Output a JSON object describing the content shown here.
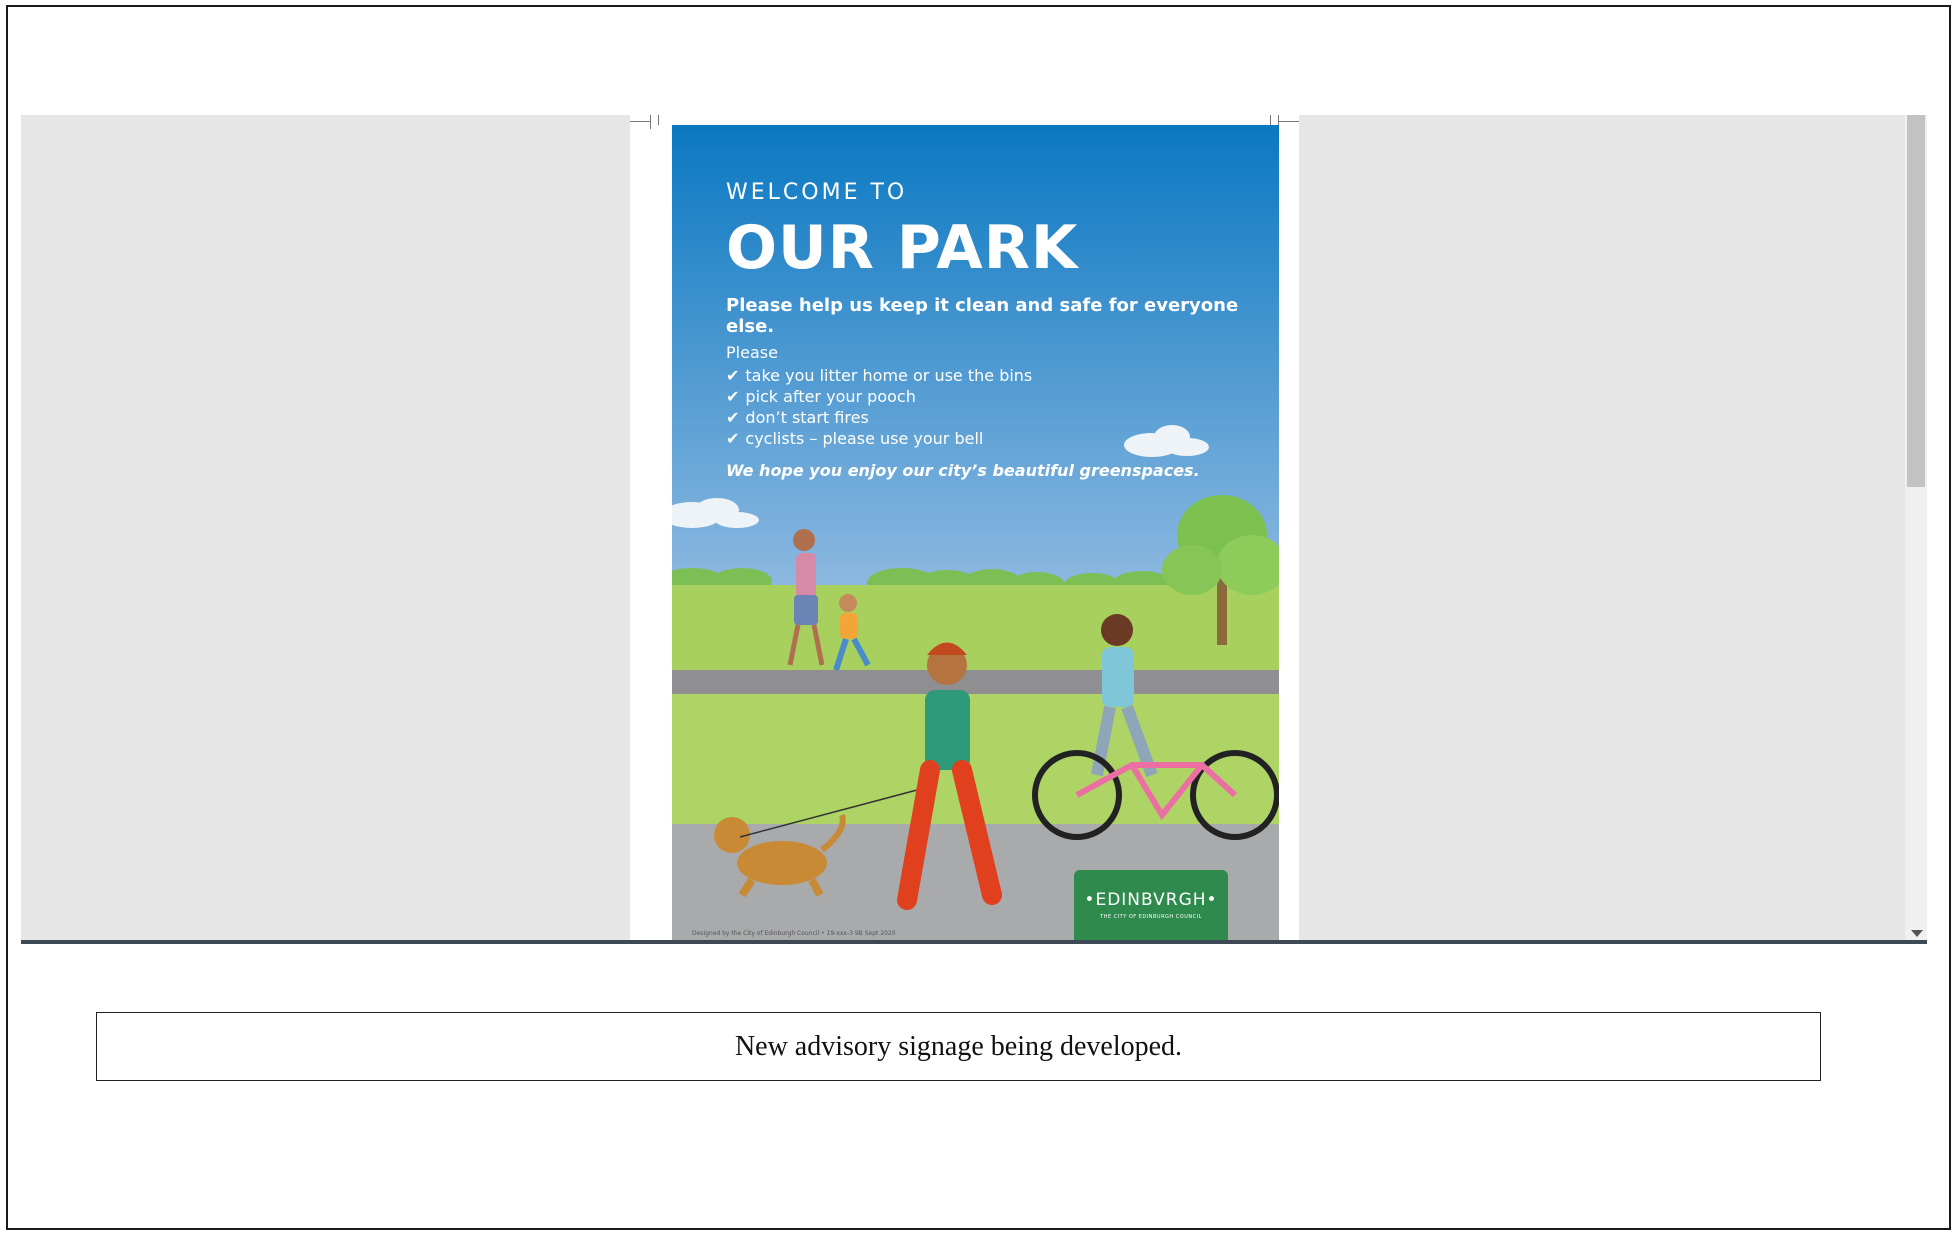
{
  "poster": {
    "welcome": "WELCOME TO",
    "title": "OUR PARK",
    "subtitle": "Please help us keep it clean and safe for everyone else.",
    "please": "Please",
    "checkmark": "✔",
    "rules": [
      "take you litter home or use the bins",
      "pick after your pooch",
      "don’t start fires",
      "cyclists – please use your bell"
    ],
    "closing": "We hope you enjoy our city’s beautiful greenspaces.",
    "footnote": "Designed by the City of Edinburgh Council • 19-xxx-3 9B Sept 2020",
    "logo": {
      "word": "•EDINBVRGH•",
      "sub": "THE CITY OF EDINBURGH COUNCIL"
    },
    "colors": {
      "sky_top": "#0a78c2",
      "sky_bottom": "#8cb8e0",
      "grass": "#a8d05f",
      "path": "#a9aaac",
      "logo_green": "#2f8a4e"
    }
  },
  "caption": "New advisory signage being developed."
}
